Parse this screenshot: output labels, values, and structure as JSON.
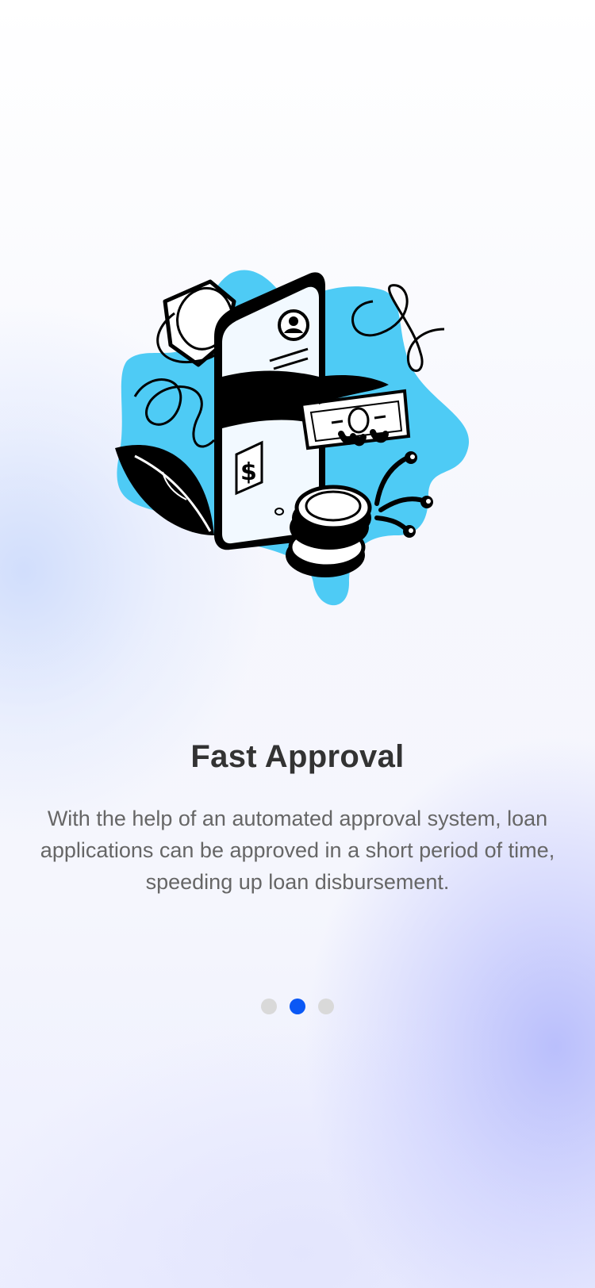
{
  "onboarding": {
    "title": "Fast Approval",
    "description": "With the help of an automated approval system, loan applications can be approved in a short period of time, speeding up loan disbursement.",
    "page_indicator": {
      "total": 3,
      "active_index": 1
    },
    "illustration": {
      "icon": "phone-money-approval-illustration",
      "accent_color": "#4ECBF5"
    }
  },
  "colors": {
    "title": "#333333",
    "description": "#666666",
    "dot_active": "#0A58F5",
    "dot_inactive": "#D9D9D9"
  }
}
